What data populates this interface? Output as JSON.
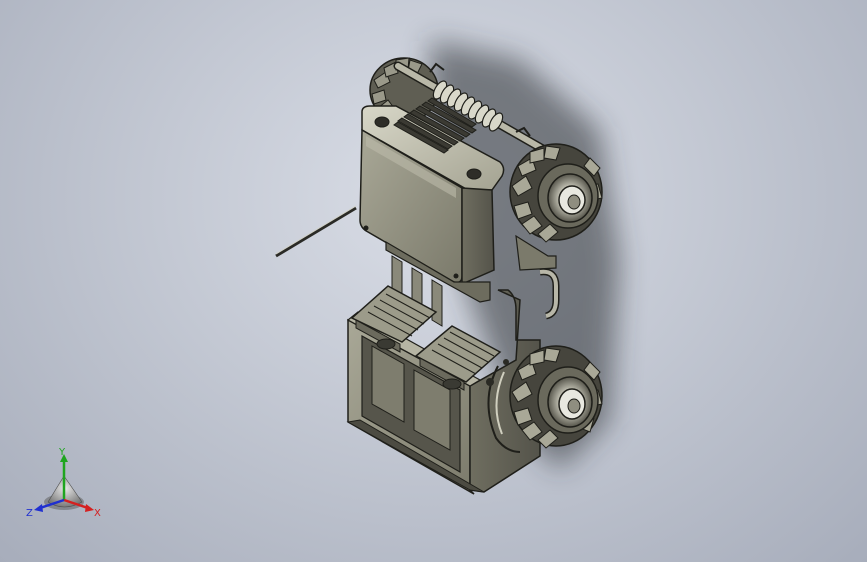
{
  "viewport": {
    "background_top": "#d9dde6",
    "background_bottom": "#a7adbb"
  },
  "model": {
    "part_color": "#8d8c7c",
    "part_shade": "#5e5d52",
    "part_light": "#c9c8b8",
    "edge_color": "#1f1f1a"
  },
  "triad": {
    "x_label": "X",
    "y_label": "Y",
    "z_label": "Z",
    "x_color": "#d42020",
    "y_color": "#1fa51f",
    "z_color": "#2030d0"
  }
}
